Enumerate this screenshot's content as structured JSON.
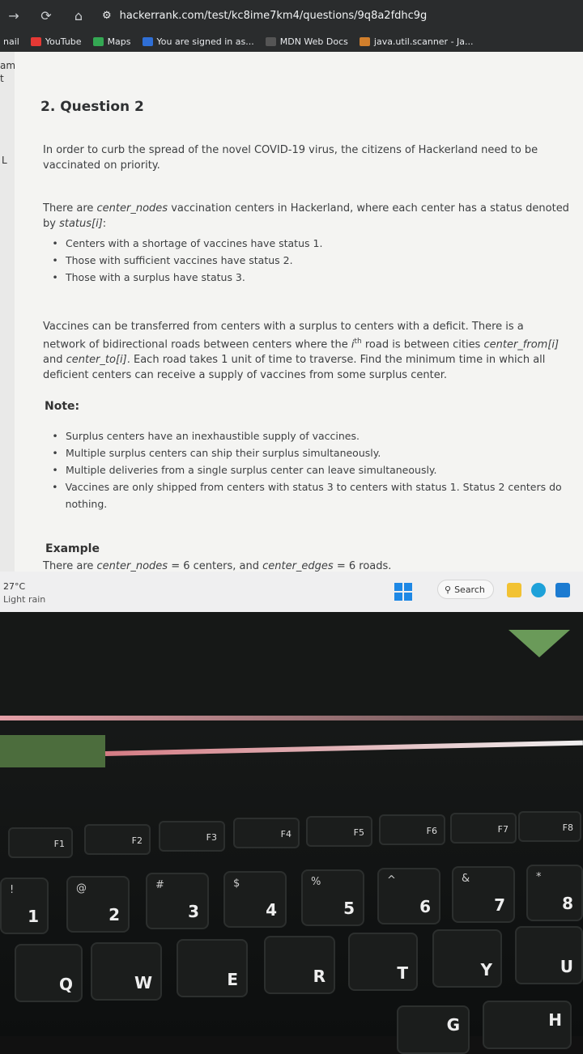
{
  "browser": {
    "url": "hackerrank.com/test/kc8ime7km4/questions/9q8a2fdhc9g",
    "bookmarks": [
      "nail",
      "YouTube",
      "Maps",
      "You are signed in as...",
      "MDN Web Docs",
      "java.util.scanner - Ja..."
    ]
  },
  "sidebar": {
    "labels": [
      "am",
      "t",
      "L"
    ]
  },
  "question": {
    "title": "2. Question 2",
    "intro": "In order to curb the spread of the novel COVID-19 virus, the citizens of Hackerland need to be vaccinated on priority.",
    "centers_a": "There are ",
    "centers_var": "center_nodes",
    "centers_b": " vaccination centers in Hackerland, where each center has a status denoted by ",
    "centers_var2": "status[i]",
    "centers_c": ":",
    "status_list": [
      "Centers with a shortage of vaccines have status 1.",
      "Those with sufficient vaccines have status 2.",
      "Those with a surplus have status 3."
    ],
    "transfer_a": "Vaccines can be transferred from centers with a surplus to centers with a deficit. There is a network of bidirectional roads between centers where the ",
    "transfer_ith": "i",
    "transfer_th": "th",
    "transfer_b": " road is between cities ",
    "transfer_var1": "center_from[i]",
    "transfer_c": " and ",
    "transfer_var2": "center_to[i]",
    "transfer_d": ". Each road takes 1 unit of time to traverse. Find the minimum time in which all deficient centers can receive a supply of vaccines from some surplus center.",
    "note_label": "Note:",
    "notes": [
      "Surplus centers have an inexhaustible supply of vaccines.",
      "Multiple surplus centers can ship their surplus simultaneously.",
      "Multiple deliveries from a single surplus center can leave simultaneously.",
      "Vaccines are only shipped from centers with status 3 to centers with status 1. Status 2 centers do nothing."
    ],
    "example_label": "Example",
    "example_a": "There are ",
    "example_var1": "center_nodes",
    "example_b": " = 6 centers, and ",
    "example_var2": "center_edges",
    "example_c": " = 6 roads."
  },
  "taskbar": {
    "temp": "27°C",
    "weather": "Light rain",
    "search": "Search"
  },
  "keyboard": {
    "fkeys": [
      "F1",
      "F2",
      "F3",
      "F4",
      "F5",
      "F6",
      "F7",
      "F8"
    ],
    "numbers": [
      {
        "sub": "!",
        "main": "1"
      },
      {
        "sub": "@",
        "main": "2"
      },
      {
        "sub": "#",
        "main": "3"
      },
      {
        "sub": "$",
        "main": "4"
      },
      {
        "sub": "%",
        "main": "5"
      },
      {
        "sub": "^",
        "main": "6"
      },
      {
        "sub": "&",
        "main": "7"
      },
      {
        "sub": "*",
        "main": "8"
      }
    ],
    "letters": [
      "Q",
      "W",
      "E",
      "R",
      "T",
      "Y",
      "U"
    ],
    "bottom": [
      "G",
      "H"
    ]
  }
}
